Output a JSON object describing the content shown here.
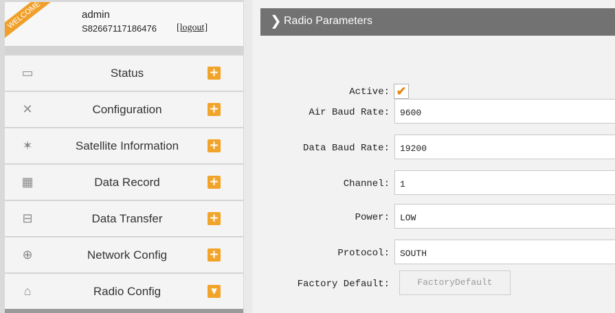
{
  "user": {
    "welcome": "WELCOME",
    "name": "admin",
    "serial": "S82667117186476",
    "logout": "[logout]"
  },
  "nav": {
    "items": [
      {
        "label": "Status",
        "icon": "monitor-icon",
        "glyph": "▭",
        "toggle": "+"
      },
      {
        "label": "Configuration",
        "icon": "tools-icon",
        "glyph": "✕",
        "toggle": "+"
      },
      {
        "label": "Satellite Information",
        "icon": "satellite-icon",
        "glyph": "✶",
        "toggle": "+"
      },
      {
        "label": "Data Record",
        "icon": "calendar-icon",
        "glyph": "▦",
        "toggle": "+"
      },
      {
        "label": "Data Transfer",
        "icon": "network-icon",
        "glyph": "⊟",
        "toggle": "+"
      },
      {
        "label": "Network Config",
        "icon": "globe-icon",
        "glyph": "⊕",
        "toggle": "+"
      },
      {
        "label": "Radio Config",
        "icon": "radio-tower-icon",
        "glyph": "⌂",
        "toggle": "▾"
      }
    ]
  },
  "panel": {
    "title": "Radio Parameters"
  },
  "form": {
    "active_label": "Active:",
    "active_checked": "✔",
    "air_baud_label": "Air Baud Rate:",
    "air_baud_value": "9600",
    "data_baud_label": "Data Baud Rate:",
    "data_baud_value": "19200",
    "channel_label": "Channel:",
    "channel_value": "1",
    "power_label": "Power:",
    "power_value": "LOW",
    "protocol_label": "Protocol:",
    "protocol_value": "SOUTH",
    "factory_label": "Factory Default:",
    "factory_button": "FactoryDefault"
  },
  "colors": {
    "accent": "#f1a42a",
    "header": "#727272"
  }
}
